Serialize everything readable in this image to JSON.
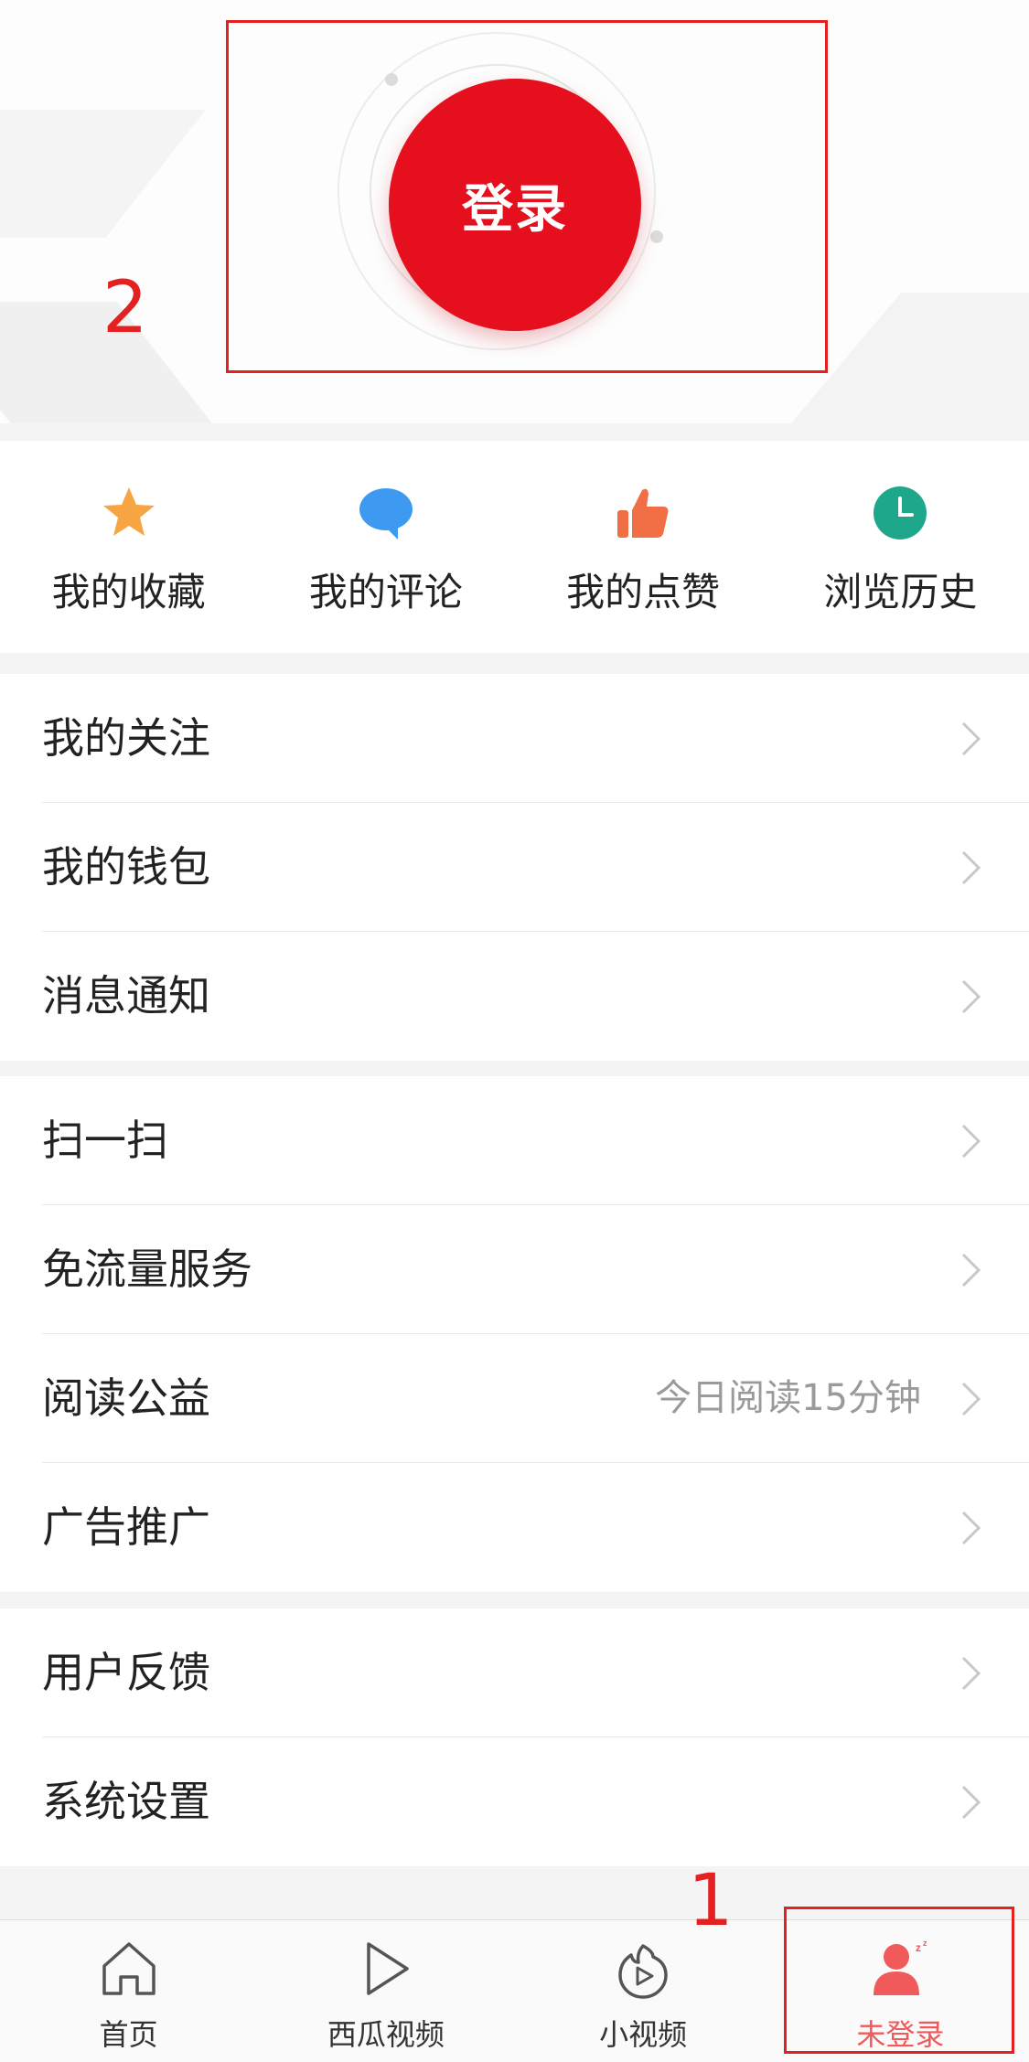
{
  "header": {
    "login_label": "登录"
  },
  "annotations": {
    "box1_number": "1",
    "box2_number": "2"
  },
  "quick_actions": [
    {
      "label": "我的收藏",
      "icon": "star-icon",
      "color": "#f7a542"
    },
    {
      "label": "我的评论",
      "icon": "comment-icon",
      "color": "#3d9af0"
    },
    {
      "label": "我的点赞",
      "icon": "thumbs-up-icon",
      "color": "#f26f45"
    },
    {
      "label": "浏览历史",
      "icon": "clock-icon",
      "color": "#1ea78a"
    }
  ],
  "menu_groups": [
    {
      "items": [
        {
          "label": "我的关注"
        },
        {
          "label": "我的钱包"
        },
        {
          "label": "消息通知"
        }
      ]
    },
    {
      "items": [
        {
          "label": "扫一扫"
        },
        {
          "label": "免流量服务"
        },
        {
          "label": "阅读公益",
          "extra": "今日阅读15分钟"
        },
        {
          "label": "广告推广"
        }
      ]
    },
    {
      "items": [
        {
          "label": "用户反馈"
        },
        {
          "label": "系统设置"
        }
      ]
    }
  ],
  "tabbar": {
    "tabs": [
      {
        "label": "首页",
        "icon": "home-icon"
      },
      {
        "label": "西瓜视频",
        "icon": "play-icon"
      },
      {
        "label": "小视频",
        "icon": "flame-play-icon"
      },
      {
        "label": "未登录",
        "icon": "user-sleep-icon",
        "active": true
      }
    ]
  },
  "colors": {
    "accent": "#e60f1e",
    "annotation": "#e42020",
    "active_tab": "#f05a5a"
  }
}
